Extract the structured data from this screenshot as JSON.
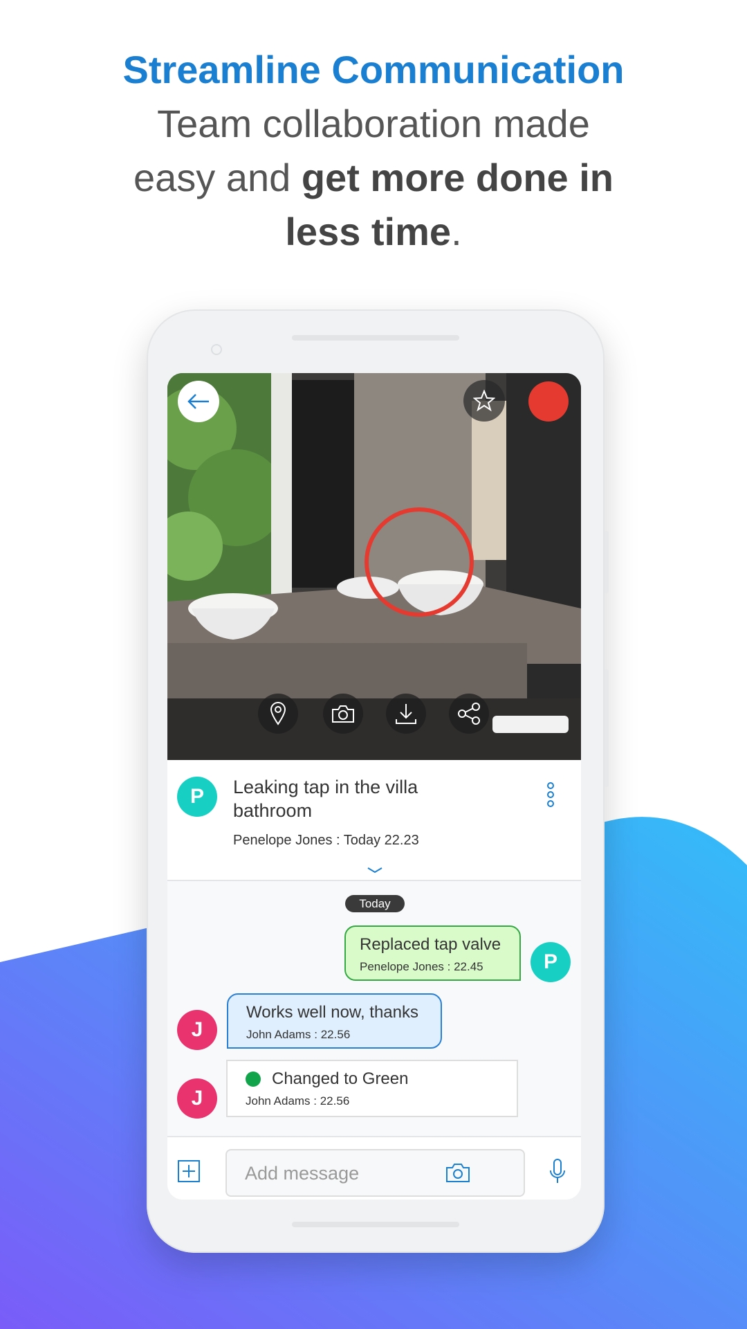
{
  "headline": {
    "line1": "Streamline Communication",
    "line2": "Team collaboration made",
    "line3_light": "easy and ",
    "line3_bold": "get more done in",
    "line4_bold": "less time",
    "line4_end": "."
  },
  "colors": {
    "brand_blue": "#1b7fd1",
    "record_red": "#e53a2f",
    "avatar_p": "#17d0c3",
    "avatar_j": "#e8336f",
    "status_green": "#12a44a"
  },
  "photo": {
    "icons": [
      "back-arrow-icon",
      "star-icon",
      "record-icon",
      "location-pin-icon",
      "camera-icon",
      "download-icon",
      "share-icon"
    ]
  },
  "task": {
    "avatar": "P",
    "title": "Leaking tap in the villa bathroom",
    "meta": "Penelope Jones : Today 22.23"
  },
  "chat": {
    "date_label": "Today",
    "messages": [
      {
        "avatar": "P",
        "text": "Replaced tap valve",
        "meta": "Penelope Jones : 22.45"
      },
      {
        "avatar": "J",
        "text": "Works well now, thanks",
        "meta": "John Adams : 22.56"
      },
      {
        "avatar": "J",
        "text": "Changed to Green",
        "meta": "John Adams : 22.56"
      }
    ]
  },
  "composer": {
    "placeholder": "Add message"
  }
}
